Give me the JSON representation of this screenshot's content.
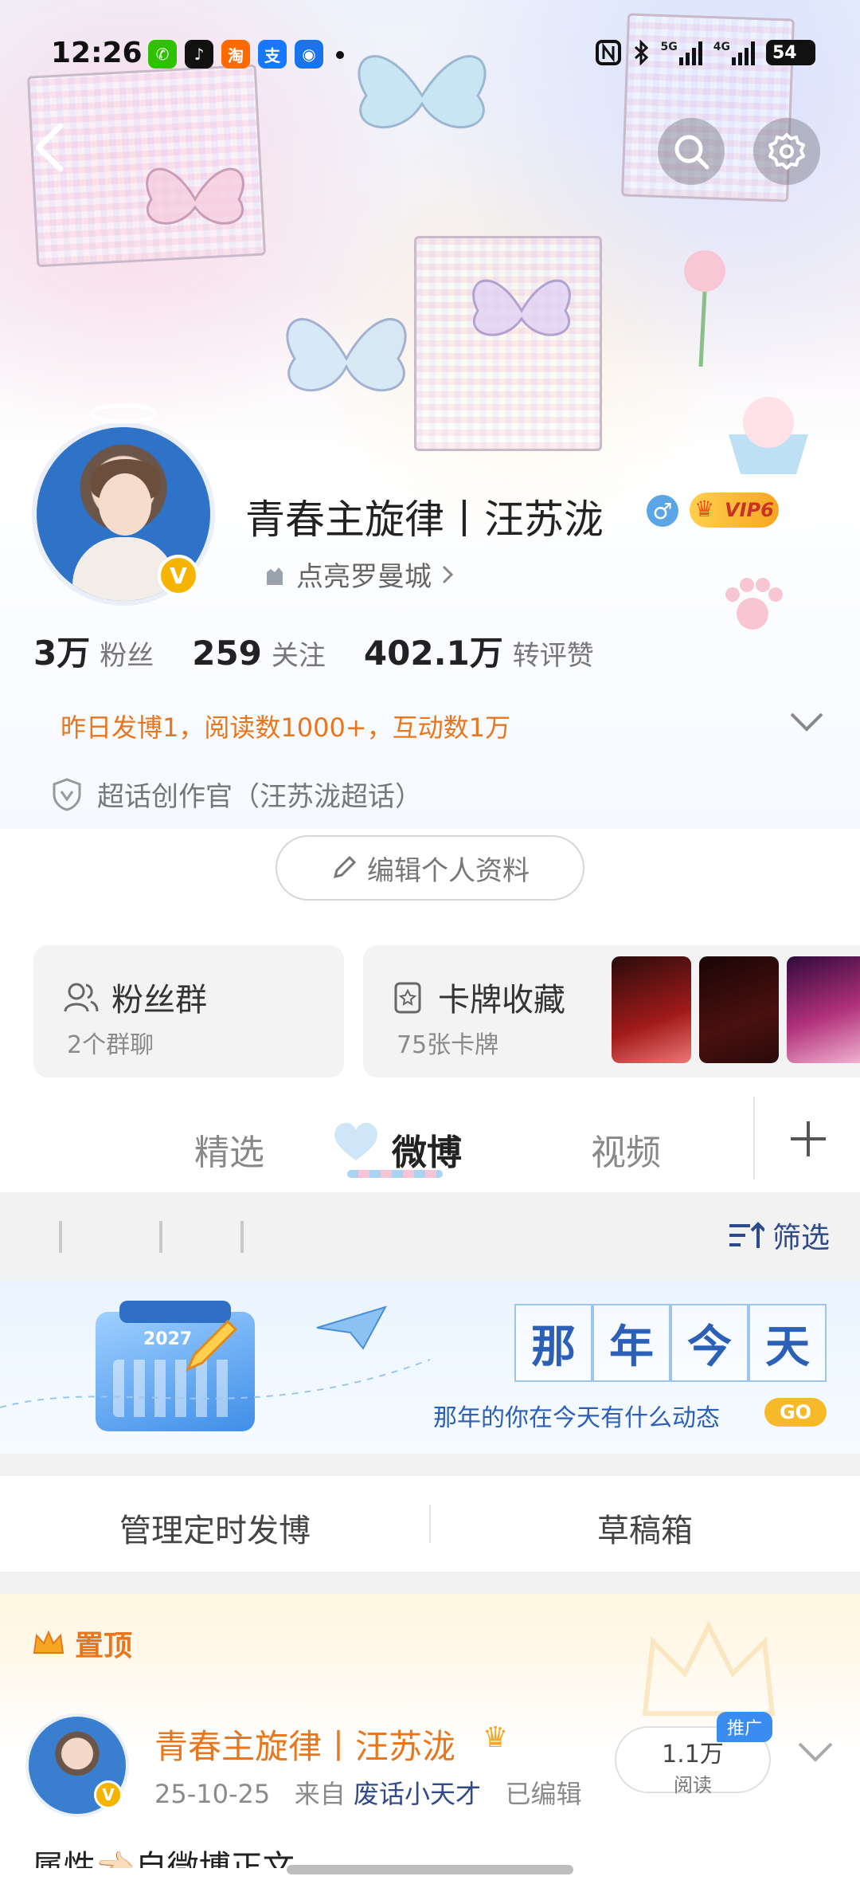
{
  "status_bar": {
    "time": "12:26",
    "apps": [
      {
        "icon": "wechat-icon",
        "label": "✆",
        "color": "#2dc100"
      },
      {
        "icon": "tiktok-icon",
        "label": "♪",
        "color": "#111111"
      },
      {
        "icon": "taobao-icon",
        "label": "淘",
        "color": "#ff6a00"
      },
      {
        "icon": "alipay-icon",
        "label": "支",
        "color": "#1677ff"
      },
      {
        "icon": "app-icon",
        "label": "◉",
        "color": "#1a73e8"
      }
    ],
    "network_1": "5G",
    "network_2": "4G",
    "battery": "54"
  },
  "profile": {
    "nickname": "青春主旋律丨汪苏泷",
    "gender_symbol": "♂",
    "vip_label": "VIP6",
    "verified_mark": "V",
    "location": "点亮罗曼城",
    "stats": [
      {
        "value": "3万",
        "label": "粉丝"
      },
      {
        "value": "259",
        "label": "关注"
      },
      {
        "value": "402.1万",
        "label": "转评赞"
      }
    ],
    "activity": "昨日发博1，阅读数1000+，互动数1万",
    "creator_title": "超话创作官（汪苏泷超话）",
    "edit_label": "编辑个人资料"
  },
  "cards": {
    "fans_group": {
      "title": "粉丝群",
      "subtitle": "2个群聊"
    },
    "card_collection": {
      "title": "卡牌收藏",
      "subtitle": "75张卡牌"
    }
  },
  "tabs": [
    "精选",
    "微博",
    "视频"
  ],
  "active_tab": "微博",
  "filter_label": "筛选",
  "memory_banner": {
    "chars": [
      "那",
      "年",
      "今",
      "天"
    ],
    "subtitle": "那年的你在今天有什么动态",
    "go_label": "GO",
    "calendar_year": "2027"
  },
  "manage": {
    "scheduled": "管理定时发博",
    "drafts": "草稿箱"
  },
  "pinned_post": {
    "pin_label": "置顶",
    "author": "青春主旋律丨汪苏泷",
    "date": "25-10-25",
    "source_prefix": "来自",
    "source": "废话小天才",
    "edited": "已编辑",
    "reads_value": "1.1万",
    "reads_label": "阅读",
    "promo_label": "推广",
    "text_preview": "属性👈🏻自微博正文"
  },
  "colors": {
    "accent_orange": "#e8761d",
    "link_blue": "#2f4a8a",
    "verified_gold": "#f5b400"
  }
}
